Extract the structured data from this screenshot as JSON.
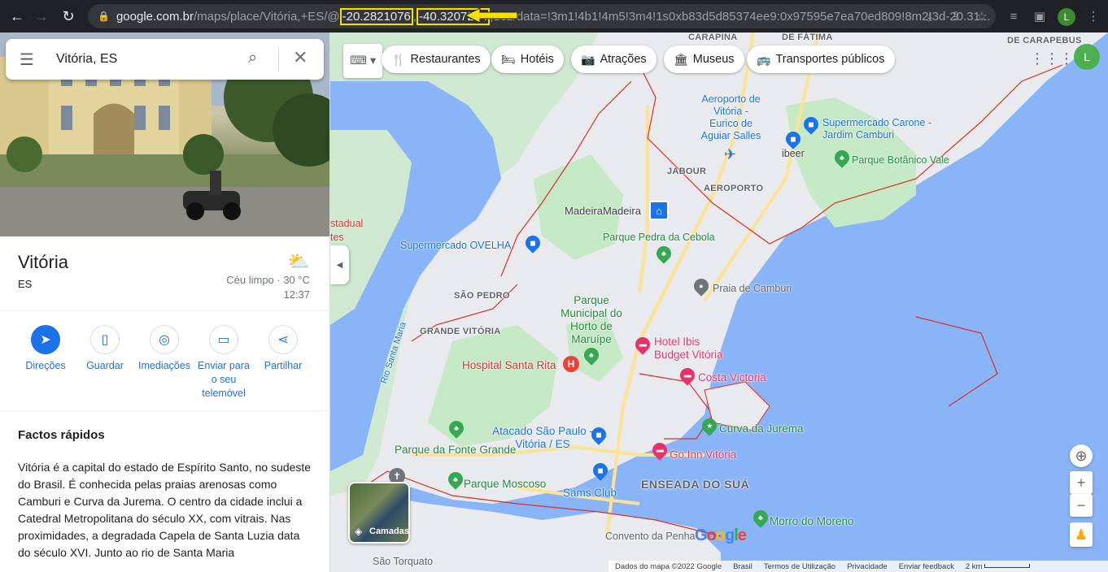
{
  "browser": {
    "url_host": "google.com.br",
    "url_path_before": "/maps/place/Vitória,+ES/@",
    "url_lat": "-20.2821076",
    "url_sep": ",",
    "url_lng": "-40.3207234",
    "url_path_after": ",13z/data=!3m1!4b1!4m5!3m4!1s0xb83d5d85374ee9:0x97595e7ea70ed809!8m2!3d-20.31...",
    "avatar_letter": "L"
  },
  "search": {
    "value": "Vitória, ES"
  },
  "place": {
    "name": "Vitória",
    "state": "ES",
    "weather_condition": "Céu limpo · 30 °C",
    "weather_time": "12:37"
  },
  "actions": [
    {
      "label": "Direções"
    },
    {
      "label": "Guardar"
    },
    {
      "label": "Imediações"
    },
    {
      "label": "Enviar para o seu telemóvel"
    },
    {
      "label": "Partilhar"
    }
  ],
  "facts": {
    "heading": "Factos rápidos",
    "text": "Vitória é a capital do estado de Espírito Santo, no sudeste do Brasil. É conhecida pelas praias arenosas como Camburi e Curva da Jurema. O centro da cidade inclui a Catedral Metropolitana do século XX, com vitrais. Nas proximidades, a degradada Capela de Santa Luzia data do século XVI. Junto ao rio de Santa Maria"
  },
  "chips": [
    {
      "label": "Restaurantes",
      "icon": "fork-knife-icon"
    },
    {
      "label": "Hotéis",
      "icon": "bed-icon"
    },
    {
      "label": "Atrações",
      "icon": "camera-icon"
    },
    {
      "label": "Museus",
      "icon": "museum-icon"
    },
    {
      "label": "Transportes públicos",
      "icon": "bus-icon"
    }
  ],
  "map_labels": {
    "carapina": "CARAPINA",
    "fatima": "DE FÁTIMA",
    "carapebus": "DE CARAPEBUS",
    "aeroporto_name": "Aeroporto de Vitória - Eurico de Aguiar Salles",
    "supermercado_carone": "Supermercado Carone - Jardim Camburi",
    "ibeer": "ibeer",
    "parque_botanico": "Parque Botânico Vale",
    "jabour": "JABOUR",
    "aeroporto": "AEROPORTO",
    "madeira": "MadeiraMadeira",
    "estadual": "stadual",
    "estadual2": "tes",
    "supermercado_ovelha": "Supermercado OVELHA",
    "parque_pedra": "Parque Pedra da Cebola",
    "praia_camburi": "Praia de Camburi",
    "sao_pedro": "SÃO PEDRO",
    "parque_horto": "Parque Municipal do Horto de Maruípe",
    "grande_vitoria": "GRANDE VITÓRIA",
    "hotel_ibis": "Hotel Ibis Budget Vitória",
    "rio_santa_maria": "Rio Santa Maria",
    "hospital": "Hospital Santa Rita",
    "costa_victoria": "Costa Victoria",
    "atacado": "Atacado São Paulo - Vitória / ES",
    "curva_jurema": "Curva da Jurema",
    "parque_fonte": "Parque da Fonte Grande",
    "go_inn": "Go Inn Vitória",
    "parque_moscoso": "Parque Moscoso",
    "enseada": "ENSEADA DO SUÁ",
    "sams": "Sams Club",
    "morro_moreno": "Morro do Moreno",
    "convento": "Convento da Penha",
    "sao_torquato": "São Torquato",
    "layers": "Camadas"
  },
  "attribution": {
    "data": "Dados do mapa ©2022 Google",
    "country": "Brasil",
    "terms": "Termos de Utilização",
    "privacy": "Privacidade",
    "feedback": "Enviar feedback",
    "scale": "2 km"
  },
  "colors": {
    "water": "#8ab4f8",
    "land": "#e8eaed",
    "park": "#c5e8c5",
    "road": "#fde293",
    "boundary": "#d93025",
    "accent": "#1a73e8"
  }
}
